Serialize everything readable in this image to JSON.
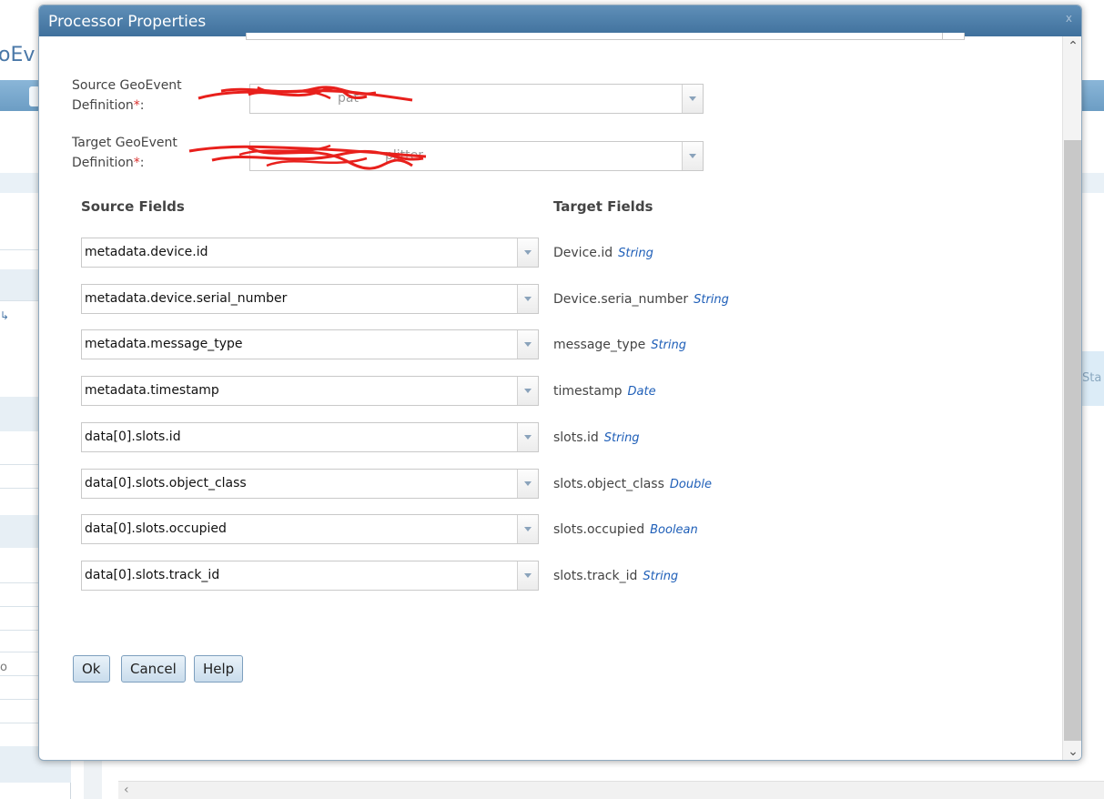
{
  "background": {
    "app_title_fragment": "oEv",
    "side_fragment": "o",
    "panel_fragment": "Sta"
  },
  "dialog": {
    "title": "Processor Properties",
    "close_glyph": "x",
    "source_def": {
      "label_line1": "Source GeoEvent",
      "label_line2": "Definition",
      "value": "pat"
    },
    "target_def": {
      "label_line1": "Target GeoEvent",
      "label_line2": "Definition",
      "value": "plitter"
    },
    "required_marker": "*",
    "label_suffix": ":",
    "headers": {
      "source": "Source Fields",
      "target": "Target Fields"
    },
    "mappings": [
      {
        "source": "metadata.device.id",
        "target": "Device.id",
        "type": "String"
      },
      {
        "source": "metadata.device.serial_number",
        "target": "Device.seria_number",
        "type": "String"
      },
      {
        "source": "metadata.message_type",
        "target": "message_type",
        "type": "String"
      },
      {
        "source": "metadata.timestamp",
        "target": "timestamp",
        "type": "Date"
      },
      {
        "source": "data[0].slots.id",
        "target": "slots.id",
        "type": "String"
      },
      {
        "source": "data[0].slots.object_class",
        "target": "slots.object_class",
        "type": "Double"
      },
      {
        "source": "data[0].slots.occupied",
        "target": "slots.occupied",
        "type": "Boolean"
      },
      {
        "source": "data[0].slots.track_id",
        "target": "slots.track_id",
        "type": "String"
      }
    ],
    "buttons": {
      "ok": "Ok",
      "cancel": "Cancel",
      "help": "Help"
    }
  }
}
